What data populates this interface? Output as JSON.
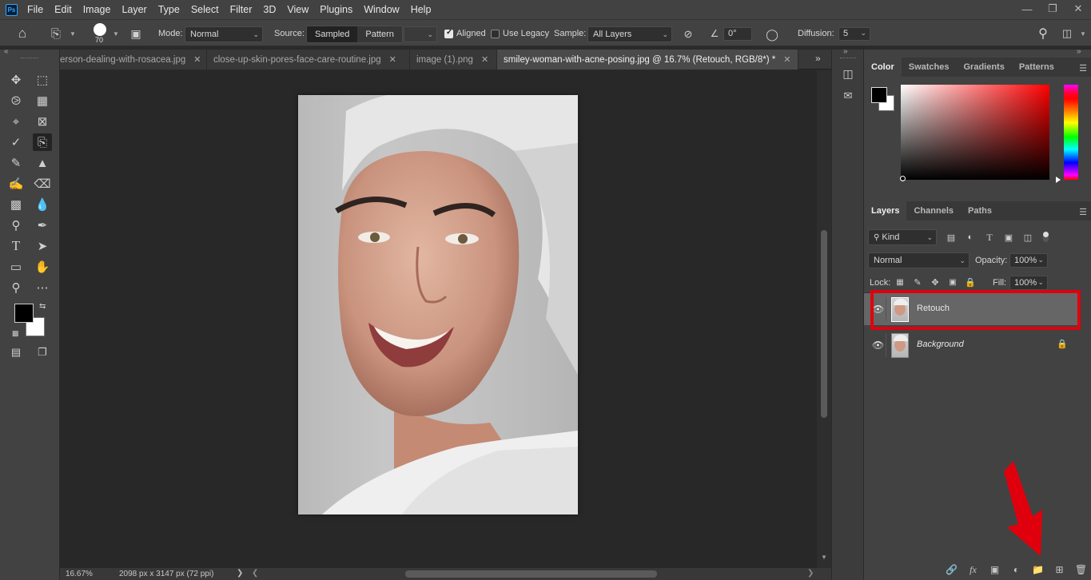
{
  "menubar": {
    "logo": "Ps",
    "items": [
      "File",
      "Edit",
      "Image",
      "Layer",
      "Type",
      "Select",
      "Filter",
      "3D",
      "View",
      "Plugins",
      "Window",
      "Help"
    ]
  },
  "options": {
    "brush_size": "70",
    "mode_label": "Mode:",
    "mode_value": "Normal",
    "source_label": "Source:",
    "source_sampled": "Sampled",
    "source_pattern": "Pattern",
    "aligned_label": "Aligned",
    "use_legacy_label": "Use Legacy",
    "sample_label": "Sample:",
    "sample_value": "All Layers",
    "angle_value": "0°",
    "diffusion_label": "Diffusion:",
    "diffusion_value": "5"
  },
  "tabs": [
    {
      "label": "erson-dealing-with-rosacea.jpg"
    },
    {
      "label": "close-up-skin-pores-face-care-routine.jpg"
    },
    {
      "label": "image (1).png"
    },
    {
      "label": "smiley-woman-with-acne-posing.jpg @ 16.7% (Retouch, RGB/8*) *"
    }
  ],
  "status": {
    "zoom": "16.67%",
    "doc_size": "2098 px x 3147 px (72 ppi)"
  },
  "color_panel": {
    "tabs": [
      "Color",
      "Swatches",
      "Gradients",
      "Patterns"
    ]
  },
  "layers_panel": {
    "tabs": [
      "Layers",
      "Channels",
      "Paths"
    ],
    "kind_label": "Kind",
    "blend_mode": "Normal",
    "opacity_label": "Opacity:",
    "opacity_value": "100%",
    "lock_label": "Lock:",
    "fill_label": "Fill:",
    "fill_value": "100%",
    "layers": [
      {
        "name": "Retouch",
        "selected": true
      },
      {
        "name": "Background",
        "locked": true
      }
    ]
  },
  "colors": {
    "highlight_box": "#e0000d",
    "arrow": "#e0000d",
    "foreground": "#000000",
    "background": "#ffffff"
  }
}
